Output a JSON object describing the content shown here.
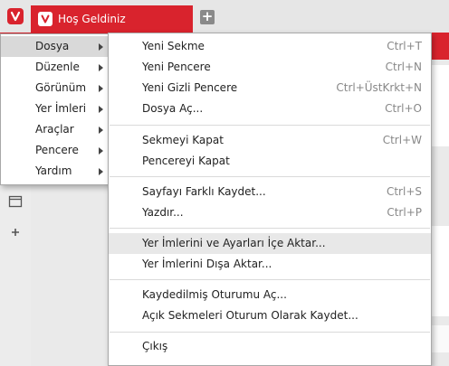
{
  "tab": {
    "title": "Hoş Geldiniz"
  },
  "main_menu": [
    {
      "label": "Dosya"
    },
    {
      "label": "Düzenle"
    },
    {
      "label": "Görünüm"
    },
    {
      "label": "Yer İmleri"
    },
    {
      "label": "Araçlar"
    },
    {
      "label": "Pencere"
    },
    {
      "label": "Yardım"
    }
  ],
  "file_menu": [
    {
      "label": "Yeni Sekme",
      "shortcut": "Ctrl+T"
    },
    {
      "label": "Yeni Pencere",
      "shortcut": "Ctrl+N"
    },
    {
      "label": "Yeni Gizli Pencere",
      "shortcut": "Ctrl+ÜstKrkt+N"
    },
    {
      "label": "Dosya Aç...",
      "shortcut": "Ctrl+O"
    },
    {
      "label": "Sekmeyi Kapat",
      "shortcut": "Ctrl+W"
    },
    {
      "label": "Pencereyi Kapat",
      "shortcut": ""
    },
    {
      "label": "Sayfayı Farklı Kaydet...",
      "shortcut": "Ctrl+S"
    },
    {
      "label": "Yazdır...",
      "shortcut": "Ctrl+P"
    },
    {
      "label": "Yer İmlerini ve Ayarları İçe Aktar...",
      "shortcut": ""
    },
    {
      "label": "Yer İmlerini Dışa Aktar...",
      "shortcut": ""
    },
    {
      "label": "Kaydedilmiş Oturumu Aç...",
      "shortcut": ""
    },
    {
      "label": "Açık Sekmeleri Oturum Olarak Kaydet...",
      "shortcut": ""
    },
    {
      "label": "Çıkış",
      "shortcut": ""
    }
  ],
  "icons": {
    "app_logo": "vivaldi-logo-icon",
    "new_tab": "plus-icon",
    "panel": "window-panel-icon",
    "add_panel": "plus-icon"
  },
  "colors": {
    "accent": "#d9232d",
    "highlight": "#e8e8e8"
  }
}
